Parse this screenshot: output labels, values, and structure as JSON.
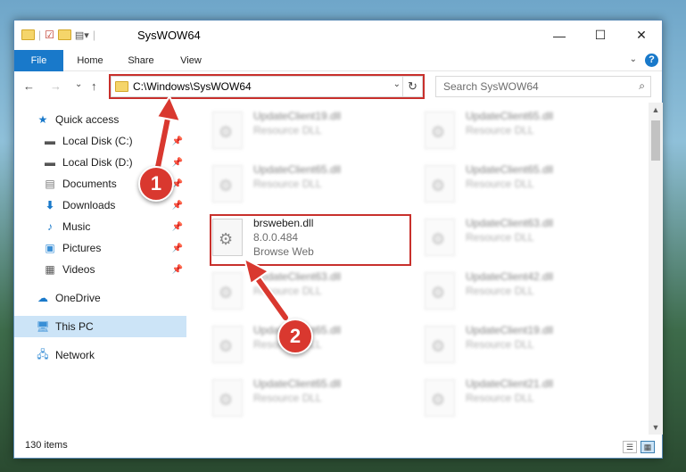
{
  "window": {
    "title": "SysWOW64",
    "minimize": "—",
    "maximize": "☐",
    "close": "✕"
  },
  "ribbon": {
    "tabs": [
      "File",
      "Home",
      "Share",
      "View"
    ],
    "expand": "⌄",
    "help": "?"
  },
  "nav": {
    "back": "←",
    "forward": "→",
    "recent": "⌄",
    "up": "↑",
    "address": "C:\\Windows\\SysWOW64",
    "address_dropdown": "⌄",
    "refresh": "↻",
    "search_placeholder": "Search SysWOW64"
  },
  "sidebar": {
    "items": [
      {
        "label": "Quick access",
        "icon": "star-icon",
        "pinned": false
      },
      {
        "label": "Local Disk (C:)",
        "icon": "drive-icon",
        "pinned": true
      },
      {
        "label": "Local Disk (D:)",
        "icon": "drive-icon",
        "pinned": true
      },
      {
        "label": "Documents",
        "icon": "documents-icon",
        "pinned": true
      },
      {
        "label": "Downloads",
        "icon": "downloads-icon",
        "pinned": true
      },
      {
        "label": "Music",
        "icon": "music-icon",
        "pinned": true
      },
      {
        "label": "Pictures",
        "icon": "pictures-icon",
        "pinned": true
      },
      {
        "label": "Videos",
        "icon": "videos-icon",
        "pinned": true
      },
      {
        "label": "OneDrive",
        "icon": "cloud-icon",
        "pinned": false
      },
      {
        "label": "This PC",
        "icon": "computer-icon",
        "pinned": false,
        "selected": true
      },
      {
        "label": "Network",
        "icon": "network-icon",
        "pinned": false
      }
    ]
  },
  "files": [
    {
      "name": "UpdateClient19.dll",
      "sub1": "Resource DLL",
      "blurred": true
    },
    {
      "name": "UpdateClient65.dll",
      "sub1": "Resource DLL",
      "blurred": true
    },
    {
      "name": "UpdateClient65.dll",
      "sub1": "Resource DLL",
      "blurred": true
    },
    {
      "name": "UpdateClient65.dll",
      "sub1": "Resource DLL",
      "blurred": true
    },
    {
      "name": "brsweben.dll",
      "sub1": "8.0.0.484",
      "sub2": "Browse Web",
      "blurred": false,
      "highlighted": true
    },
    {
      "name": "UpdateClient63.dll",
      "sub1": "Resource DLL",
      "blurred": true
    },
    {
      "name": "UpdateClient63.dll",
      "sub1": "Resource DLL",
      "blurred": true
    },
    {
      "name": "UpdateClient42.dll",
      "sub1": "Resource DLL",
      "blurred": true
    },
    {
      "name": "UpdateClient65.dll",
      "sub1": "Resource DLL",
      "blurred": true
    },
    {
      "name": "UpdateClient19.dll",
      "sub1": "Resource DLL",
      "blurred": true
    },
    {
      "name": "UpdateClient65.dll",
      "sub1": "Resource DLL",
      "blurred": true
    },
    {
      "name": "UpdateClient21.dll",
      "sub1": "Resource DLL",
      "blurred": true
    }
  ],
  "status": {
    "item_count": "130 items"
  },
  "annotations": {
    "step1": "1",
    "step2": "2",
    "color": "#d9382f"
  }
}
